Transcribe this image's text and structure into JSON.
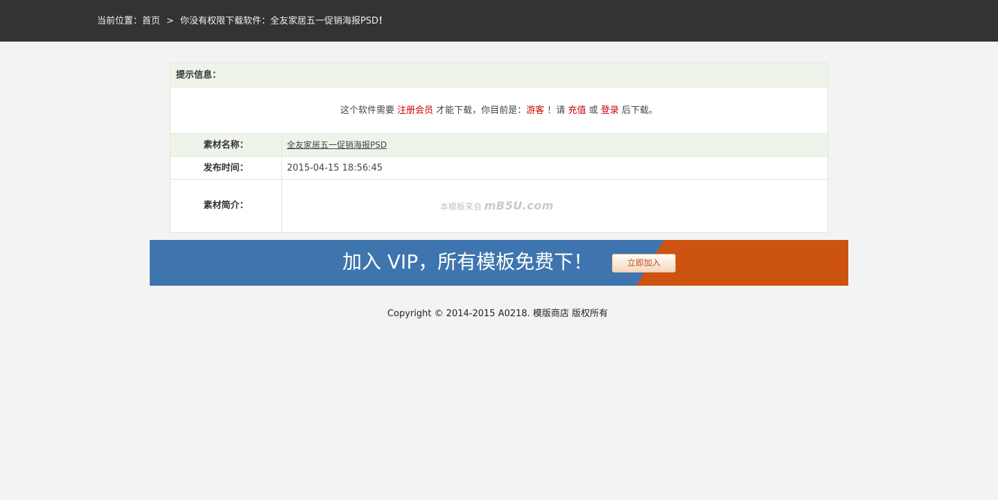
{
  "breadcrumb": {
    "label": "当前位置：",
    "home": "首页",
    "separator": ">",
    "message": "你没有权限下载软件：全友家居五一促销海报PSD",
    "exclamation": "！"
  },
  "panel": {
    "header": "提示信息：",
    "notice": {
      "text1": "这个软件需要 ",
      "register": "注册会员",
      "text2": " 才能下载，你目前是：",
      "guest": "游客",
      "text3": " ！请 ",
      "recharge": "充值",
      "text4": " 或 ",
      "login": "登录",
      "text5": " 后下载。"
    },
    "rows": {
      "name_label": "素材名称：",
      "name_value": "全友家居五一促销海报PSD",
      "time_label": "发布时间：",
      "time_value": "2015-04-15 18:56:45",
      "desc_label": "素材简介：",
      "watermark_prefix": "本模板来自",
      "watermark_logo": "mB5U.com"
    }
  },
  "banner": {
    "text": "加入 VIP，所有模板免费下！",
    "button": "立即加入"
  },
  "footer": {
    "copyright": "Copyright © 2014-2015 A0218. 模版商店 版权所有"
  },
  "colors": {
    "topbar": "#333333",
    "banner_blue": "#3f75ae",
    "banner_orange": "#cd5311",
    "link_red": "#cc0000"
  }
}
